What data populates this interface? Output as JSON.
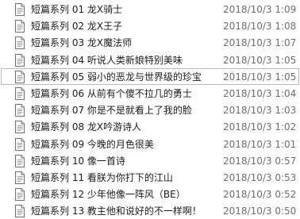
{
  "files": [
    {
      "name": "短篇系列 01 龙X骑士",
      "modified": "2018/10/3 1:09",
      "selected": false,
      "icon": "text-file-icon"
    },
    {
      "name": "短篇系列 02 龙X王子",
      "modified": "2018/10/3 1:08",
      "selected": false,
      "icon": "text-file-icon"
    },
    {
      "name": "短篇系列 03 龙X魔法师",
      "modified": "2018/10/3 1:07",
      "selected": false,
      "icon": "text-file-icon"
    },
    {
      "name": "短篇系列 04 听说人类新娘特别美味",
      "modified": "2018/10/3 1:05",
      "selected": false,
      "icon": "text-file-icon"
    },
    {
      "name": "短篇系列 05 弱小的恶龙与世界级的珍宝",
      "modified": "2018/10/3 1:05",
      "selected": true,
      "icon": "text-file-icon"
    },
    {
      "name": "短篇系列 06 从前有个傻不拉几的勇士",
      "modified": "2018/10/3 1:04",
      "selected": false,
      "icon": "text-file-icon"
    },
    {
      "name": "短篇系列 07 你是不是就看上了我的脸",
      "modified": "2018/10/3 1:03",
      "selected": false,
      "icon": "text-file-icon"
    },
    {
      "name": "短篇系列 08 龙X吟游诗人",
      "modified": "2018/10/3 1:02",
      "selected": false,
      "icon": "text-file-icon"
    },
    {
      "name": "短篇系列 09 今晚的月色很美",
      "modified": "2018/10/3 1:01",
      "selected": false,
      "icon": "text-file-icon"
    },
    {
      "name": "短篇系列 10 像一首诗",
      "modified": "2018/10/3 0:57",
      "selected": false,
      "icon": "text-file-icon"
    },
    {
      "name": "短篇系列 11 看朕为你打下的江山",
      "modified": "2018/10/3 0:53",
      "selected": false,
      "icon": "text-file-icon"
    },
    {
      "name": "短篇系列 12 少年他像一阵风（BE）",
      "modified": "2018/10/3 0:52",
      "selected": false,
      "icon": "text-file-icon"
    },
    {
      "name": "短篇系列 13 教主他和说好的不一样啊！",
      "modified": "2018/10/3 0:50",
      "selected": false,
      "icon": "text-file-icon"
    }
  ],
  "colors": {
    "date_text": "#6d6d6d",
    "name_text": "#1a1a1a",
    "selected_border": "#b9b9b9"
  }
}
